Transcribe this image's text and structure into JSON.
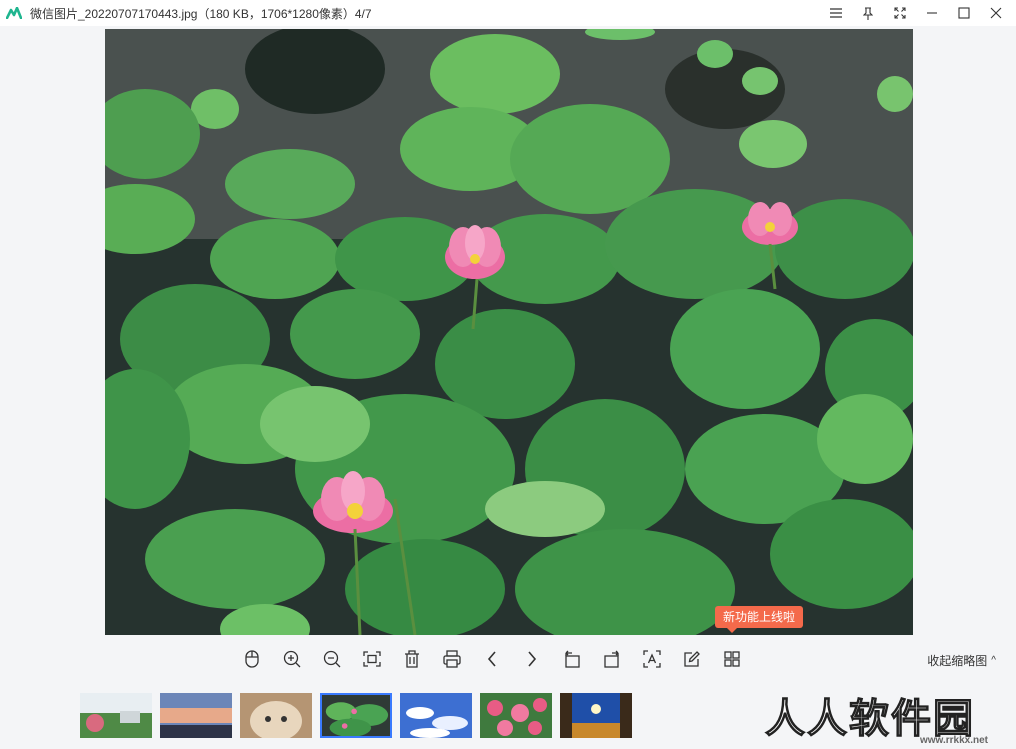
{
  "window": {
    "title": "微信图片_20220707170443.jpg（180 KB，1706*1280像素）4/7",
    "controls": [
      "menu-icon",
      "pin-icon",
      "fullscreen-icon",
      "minimize-icon",
      "maximize-icon",
      "close-icon"
    ]
  },
  "tooltip": {
    "text": "新功能上线啦"
  },
  "toolbar": {
    "tools": [
      {
        "name": "mouse-icon"
      },
      {
        "name": "zoom-in-icon"
      },
      {
        "name": "zoom-out-icon"
      },
      {
        "name": "fit-window-icon"
      },
      {
        "name": "delete-icon"
      },
      {
        "name": "print-icon"
      },
      {
        "name": "previous-icon"
      },
      {
        "name": "next-icon"
      },
      {
        "name": "rotate-left-icon"
      },
      {
        "name": "rotate-right-icon"
      },
      {
        "name": "ocr-icon"
      },
      {
        "name": "edit-icon"
      },
      {
        "name": "grid-icon"
      }
    ],
    "collapse_label": "收起缩略图",
    "collapse_chevron": "^"
  },
  "thumbnails": {
    "count": 7,
    "active_index": 3
  },
  "watermark": {
    "text": "人人软件园",
    "url": "www.rrkkx.net"
  },
  "colors": {
    "tooltip_bg": "#f46a4b",
    "active_border": "#3a7afe",
    "app_logo": "#1fb58f"
  }
}
